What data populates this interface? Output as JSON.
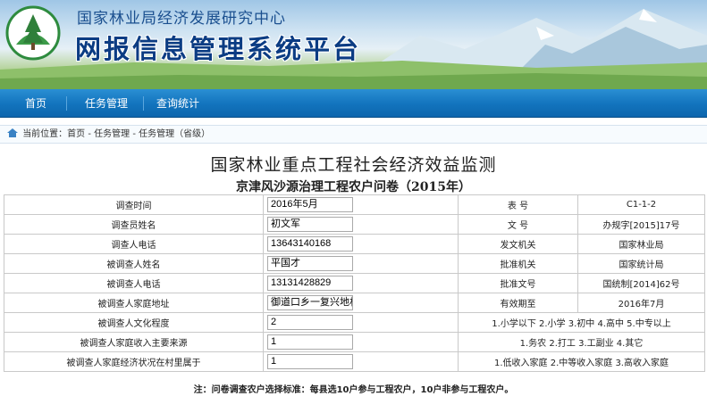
{
  "header": {
    "org_name": "国家林业局经济发展研究中心",
    "system_name": "网报信息管理系统平台"
  },
  "nav": {
    "items": [
      {
        "label": "首页"
      },
      {
        "label": "任务管理"
      },
      {
        "label": "查询统计"
      }
    ]
  },
  "breadcrumb": {
    "text": "当前位置：首页 - 任务管理 - 任务管理（省级）"
  },
  "form": {
    "title": "国家林业重点工程社会经济效益监测",
    "subtitle": "京津风沙源治理工程农户问卷（2015年）",
    "rows": [
      {
        "label": "调查时间",
        "value": "2016年5月",
        "right_label": "表  号",
        "right_value": "C1-1-2"
      },
      {
        "label": "调查员姓名",
        "value": "初文军",
        "right_label": "文  号",
        "right_value": "办规字[2015]17号"
      },
      {
        "label": "调查人电话",
        "value": "13643140168",
        "right_label": "发文机关",
        "right_value": "国家林业局"
      },
      {
        "label": "被调查人姓名",
        "value": "平国才",
        "right_label": "批准机关",
        "right_value": "国家统计局"
      },
      {
        "label": "被调查人电话",
        "value": "13131428829",
        "right_label": "批准文号",
        "right_value": "国统制[2014]62号"
      },
      {
        "label": "被调查人家庭地址",
        "value": "御道口乡一复兴地村",
        "right_label": "有效期至",
        "right_value": "2016年7月"
      },
      {
        "label": "被调查人文化程度",
        "value": "2",
        "note": "1.小学以下 2.小学 3.初中 4.高中 5.中专以上"
      },
      {
        "label": "被调查人家庭收入主要来源",
        "value": "1",
        "note": "1.务农 2.打工 3.工副业 4.其它"
      },
      {
        "label": "被调查人家庭经济状况在村里属于",
        "value": "1",
        "note": "1.低收入家庭 2.中等收入家庭 3.高收入家庭"
      }
    ],
    "footnote": "注：问卷调查农户选择标准：每县选10户参与工程农户，10户非参与工程农户。"
  }
}
